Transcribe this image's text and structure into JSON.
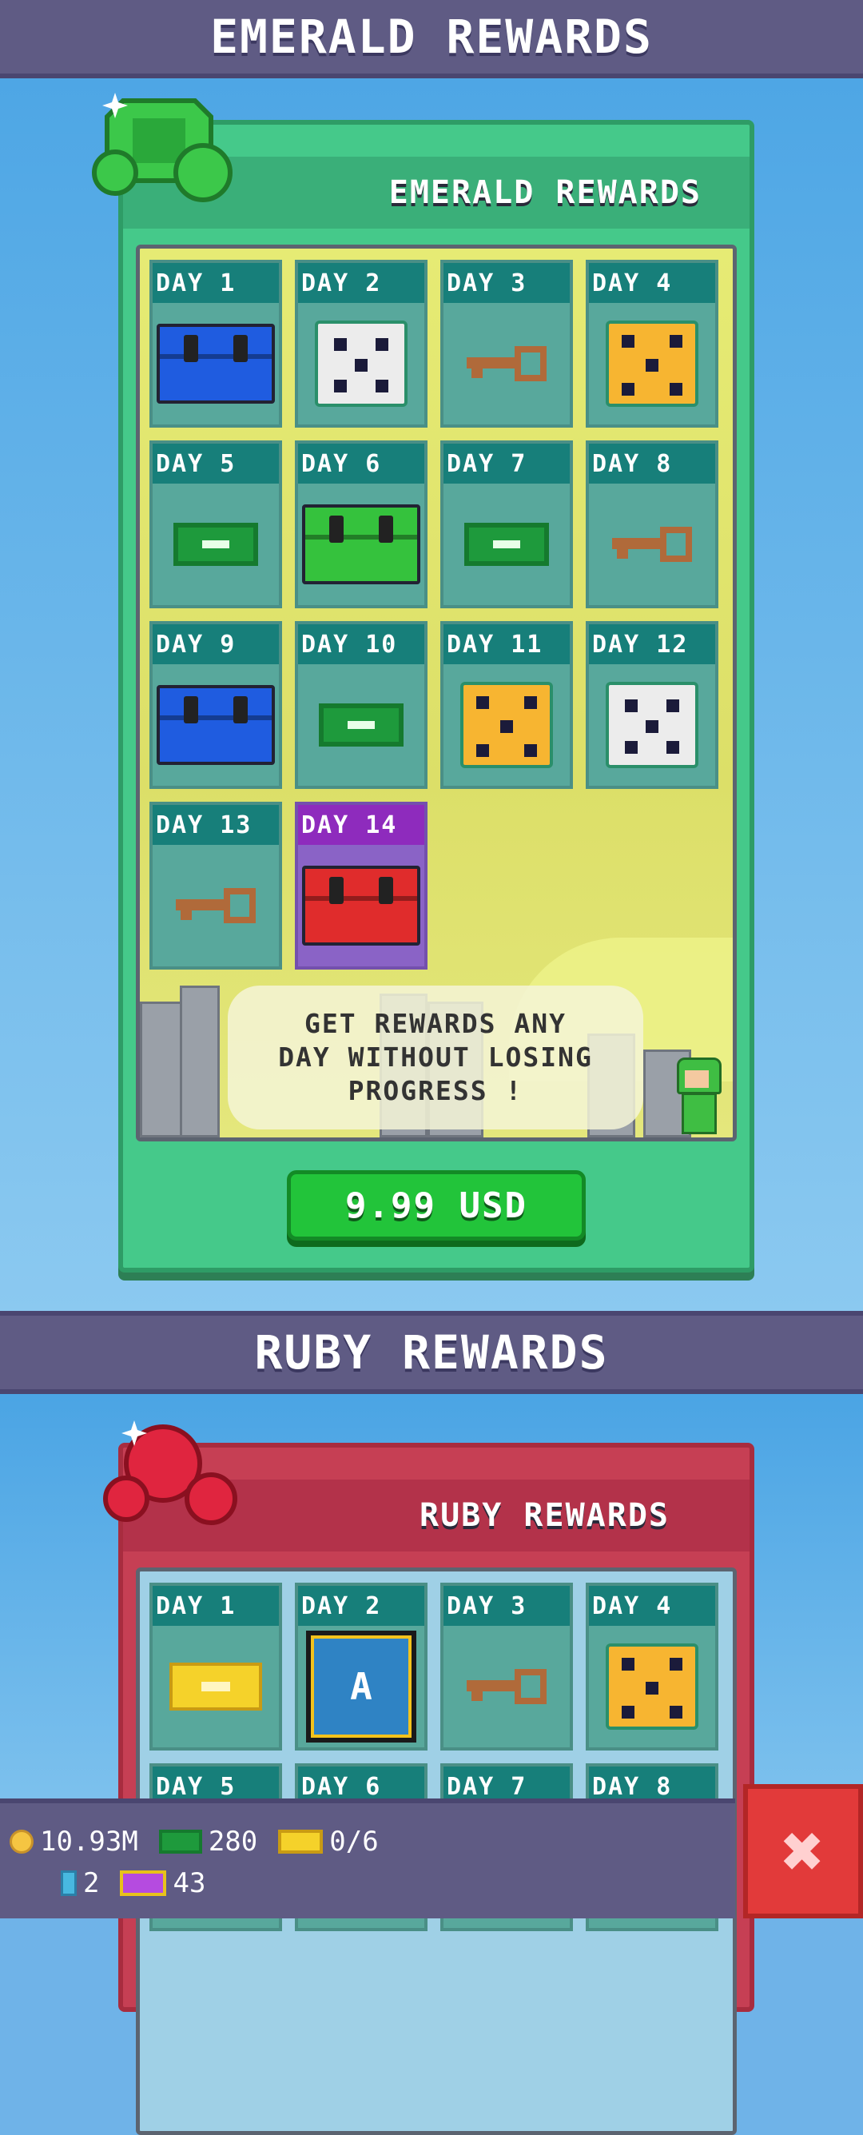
{
  "emerald_section": {
    "header": "EMERALD REWARDS",
    "panel_title": "EMERALD REWARDS",
    "days": [
      {
        "label": "DAY 1",
        "reward": "blue-chest"
      },
      {
        "label": "DAY 2",
        "reward": "white-dice"
      },
      {
        "label": "DAY 3",
        "reward": "key"
      },
      {
        "label": "DAY 4",
        "reward": "gold-dice"
      },
      {
        "label": "DAY 5",
        "reward": "cash"
      },
      {
        "label": "DAY 6",
        "reward": "green-chest"
      },
      {
        "label": "DAY 7",
        "reward": "cash"
      },
      {
        "label": "DAY 8",
        "reward": "key"
      },
      {
        "label": "DAY 9",
        "reward": "blue-chest"
      },
      {
        "label": "DAY 10",
        "reward": "cash"
      },
      {
        "label": "DAY 11",
        "reward": "gold-dice"
      },
      {
        "label": "DAY 12",
        "reward": "white-dice"
      },
      {
        "label": "DAY 13",
        "reward": "key"
      },
      {
        "label": "DAY 14",
        "reward": "red-chest"
      }
    ],
    "info_text": "GET REWARDS ANY\nDAY WITHOUT LOSING\nPROGRESS !",
    "price_label": "9.99 USD"
  },
  "ruby_section": {
    "header": "RUBY REWARDS",
    "panel_title": "RUBY REWARDS",
    "days": [
      {
        "label": "DAY 1",
        "reward": "ticket"
      },
      {
        "label": "DAY 2",
        "reward": "a-card"
      },
      {
        "label": "DAY 3",
        "reward": "key"
      },
      {
        "label": "DAY 4",
        "reward": "gold-dice"
      },
      {
        "label": "DAY 5",
        "reward": ""
      },
      {
        "label": "DAY 6",
        "reward": ""
      },
      {
        "label": "DAY 7",
        "reward": ""
      },
      {
        "label": "DAY 8",
        "reward": ""
      }
    ],
    "a_card_letter": "A"
  },
  "hud": {
    "coins": "10.93M",
    "cash": "280",
    "tickets": "0/6",
    "gems": "2",
    "cards": "43",
    "close_symbol": "✖"
  },
  "colors": {
    "emerald": "#45c98a",
    "ruby": "#c63f54",
    "bar": "#5f5b84",
    "price_button": "#22c43a",
    "close_button": "#e23a3a"
  }
}
